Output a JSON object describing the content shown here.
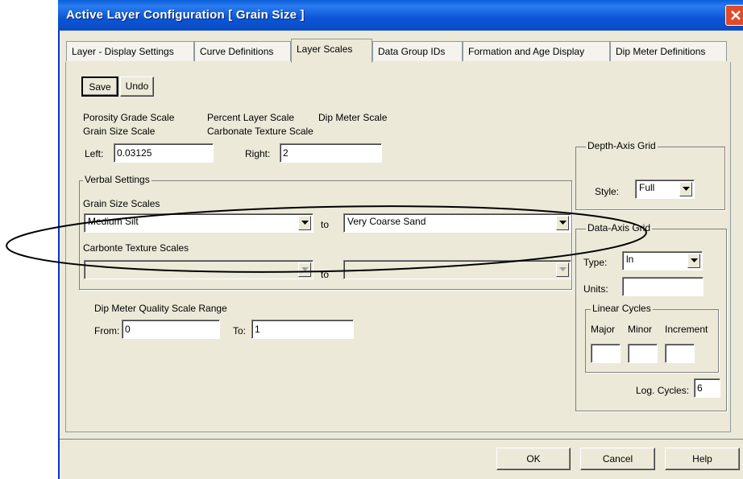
{
  "window": {
    "title": "Active Layer Configuration   [ Grain Size ]"
  },
  "tabs": [
    {
      "label": "Layer - Display Settings"
    },
    {
      "label": "Curve Definitions"
    },
    {
      "label": "Layer Scales",
      "active": true
    },
    {
      "label": "Data Group IDs"
    },
    {
      "label": "Formation and Age Display"
    },
    {
      "label": "Dip Meter Definitions"
    }
  ],
  "toolbar": {
    "save_label": "Save",
    "undo_label": "Undo"
  },
  "scales": {
    "porosity_grade": "Porosity Grade Scale",
    "percent_layer": "Percent Layer Scale",
    "dip_meter": "Dip Meter Scale",
    "grain_size": "Grain Size Scale",
    "carbonate_texture": "Carbonate Texture Scale",
    "left_label": "Left:",
    "left_value": "0.03125",
    "right_label": "Right:",
    "right_value": "2"
  },
  "verbal": {
    "group_title": "Verbal Settings",
    "grain_size_scales_label": "Grain Size Scales",
    "grain_from": "Medium Silt",
    "grain_to": "Very Coarse Sand",
    "to_label": "to",
    "carbonate_label": "Carbonte Texture Scales",
    "carb_from": "",
    "carb_to": "",
    "carb_to_label": "to"
  },
  "dip_meter": {
    "range_label": "Dip Meter Quality Scale Range",
    "from_label": "From:",
    "from_value": "0",
    "to_label": "To:",
    "to_value": "1"
  },
  "depth_axis": {
    "group_title": "Depth-Axis Grid",
    "style_label": "Style:",
    "style_value": "Full"
  },
  "data_axis": {
    "group_title": "Data-Axis Grid",
    "type_label": "Type:",
    "type_value": "ln",
    "units_label": "Units:",
    "units_value": "",
    "linear_cycles_title": "Linear Cycles",
    "major_label": "Major",
    "minor_label": "Minor",
    "increment_label": "Increment",
    "log_cycles_label": "Log. Cycles:",
    "log_cycles_value": "6"
  },
  "footer": {
    "ok_label": "OK",
    "cancel_label": "Cancel",
    "help_label": "Help"
  },
  "colors": {
    "titlebar": "#0a5fd8",
    "window_bg": "#ece9d8",
    "annotation_ellipse": "#000000"
  }
}
